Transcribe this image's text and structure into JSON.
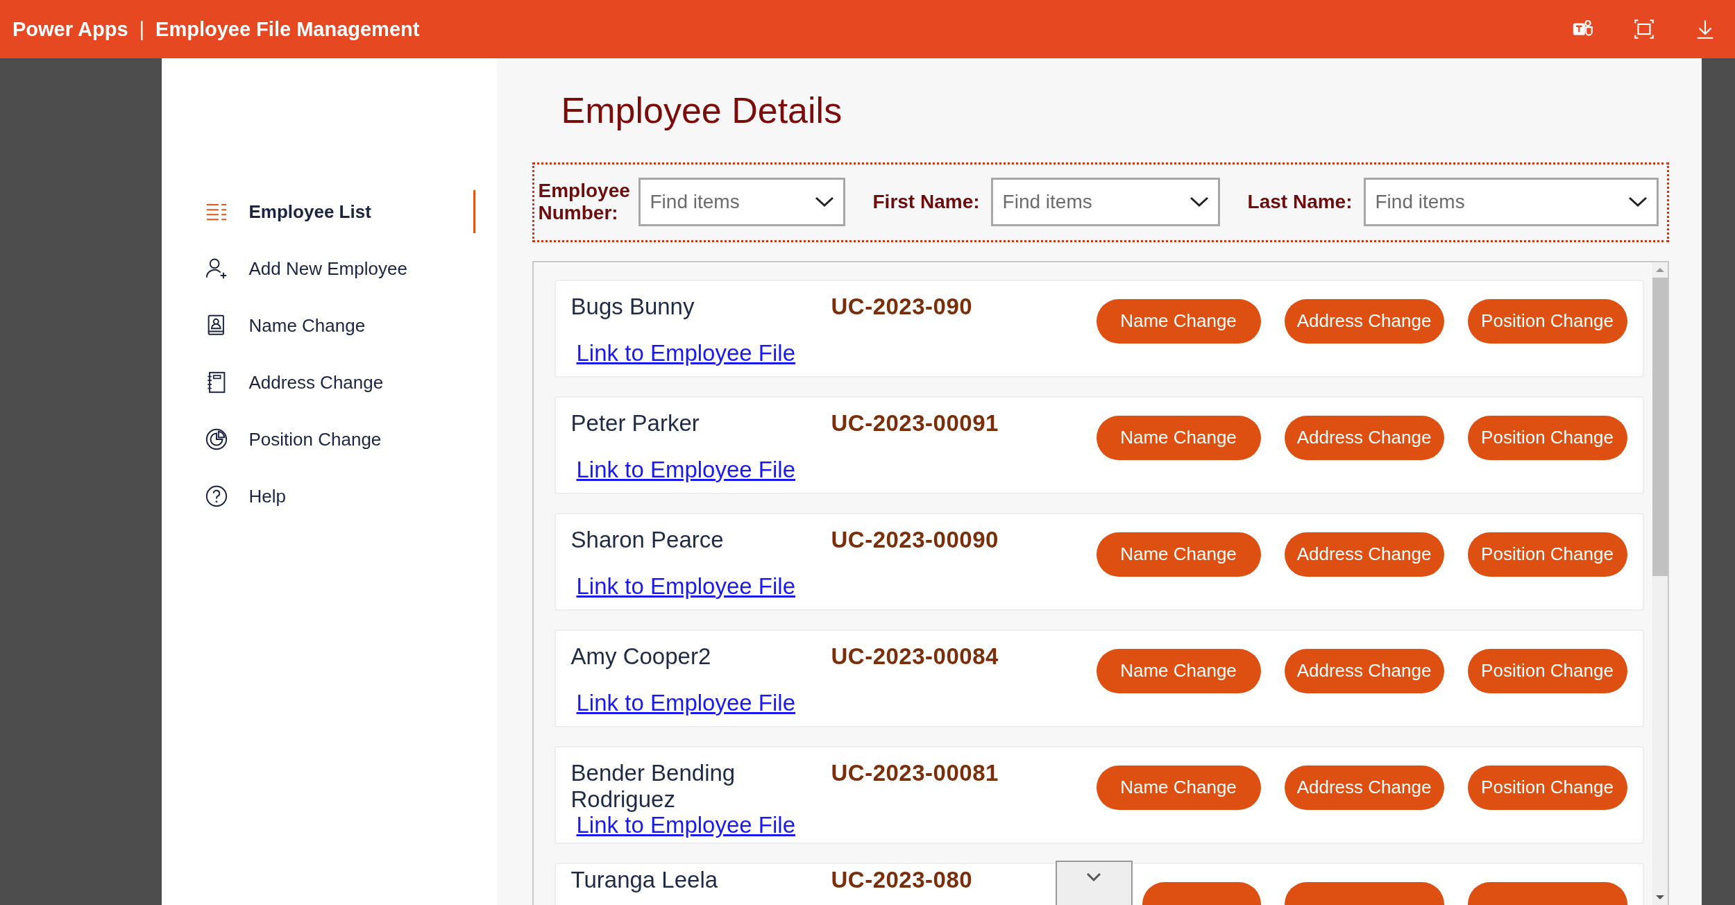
{
  "header": {
    "app": "Power Apps",
    "separator": "|",
    "title": "Employee File Management"
  },
  "sidebar": {
    "items": [
      {
        "label": "Employee List",
        "selected": true
      },
      {
        "label": "Add New Employee",
        "selected": false
      },
      {
        "label": "Name Change",
        "selected": false
      },
      {
        "label": "Address Change",
        "selected": false
      },
      {
        "label": "Position Change",
        "selected": false
      },
      {
        "label": "Help",
        "selected": false
      }
    ]
  },
  "page_title": "Employee Details",
  "filters": [
    {
      "label": "Employee Number:",
      "placeholder": "Find items"
    },
    {
      "label": "First Name:",
      "placeholder": "Find items"
    },
    {
      "label": "Last Name:",
      "placeholder": "Find items"
    }
  ],
  "employees": [
    {
      "name": "Bugs Bunny",
      "number": "UC-2023-090",
      "link": "Link to Employee File",
      "buttons": [
        "Name Change",
        "Address Change",
        "Position Change"
      ]
    },
    {
      "name": "Peter Parker",
      "number": "UC-2023-00091",
      "link": "Link to Employee File",
      "buttons": [
        "Name Change",
        "Address Change",
        "Position Change"
      ]
    },
    {
      "name": "Sharon Pearce",
      "number": "UC-2023-00090",
      "link": "Link to Employee File",
      "buttons": [
        "Name Change",
        "Address Change",
        "Position Change"
      ]
    },
    {
      "name": "Amy Cooper2",
      "number": "UC-2023-00084",
      "link": "Link to Employee File",
      "buttons": [
        "Name Change",
        "Address Change",
        "Position Change"
      ]
    },
    {
      "name": "Bender Bending Rodriguez",
      "number": "UC-2023-00081",
      "link": "Link to Employee File",
      "buttons": [
        "Name Change",
        "Address Change",
        "Position Change"
      ]
    },
    {
      "name": "Turanga Leela",
      "number": "UC-2023-080"
    }
  ]
}
